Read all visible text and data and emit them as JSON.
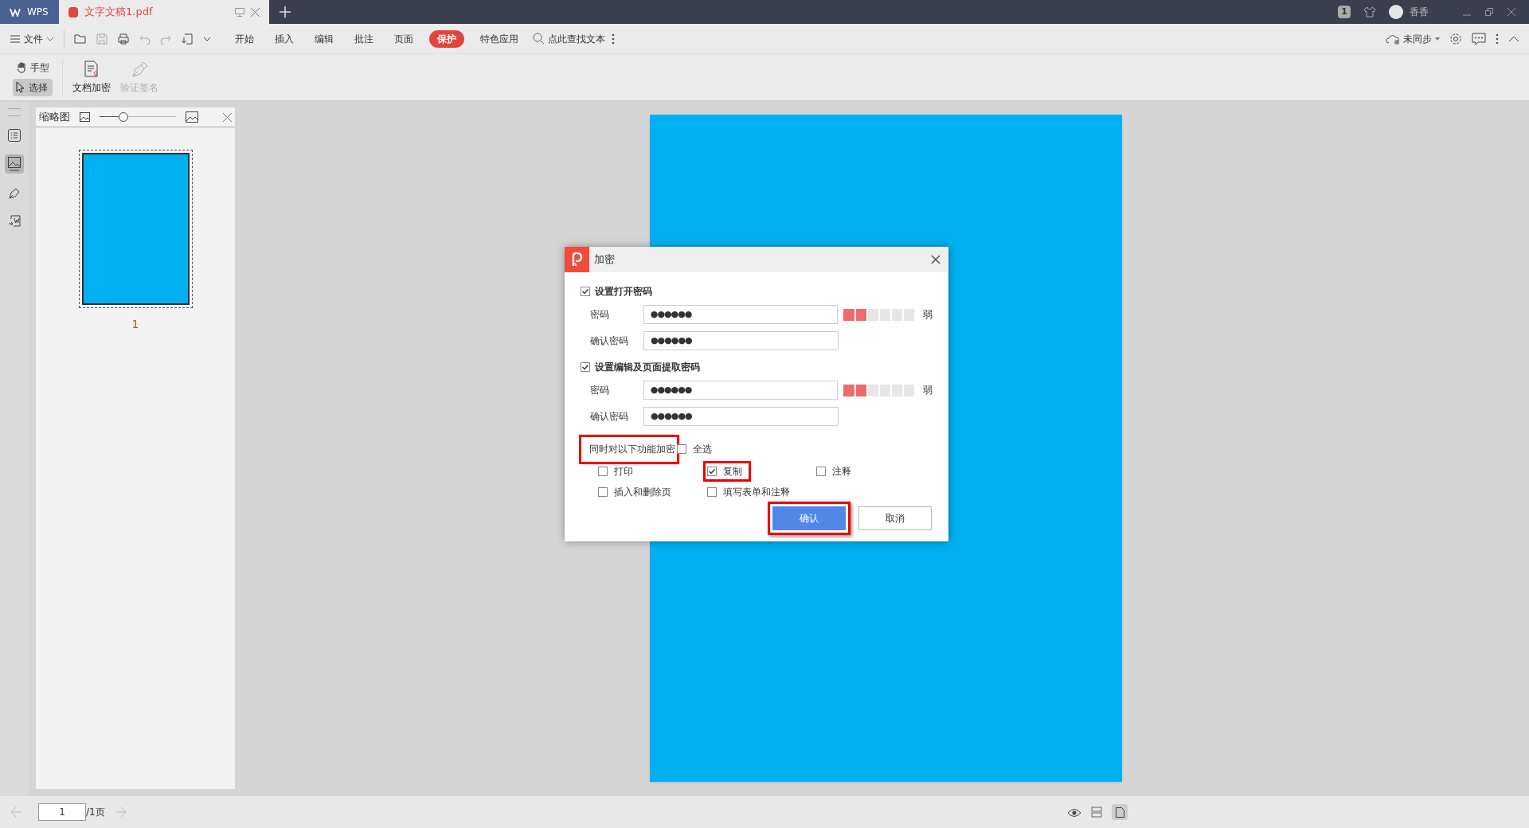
{
  "tabs": [
    {
      "label": "WPS",
      "kind": "home",
      "selected": false
    },
    {
      "label": "文字文稿1.pdf",
      "kind": "doc",
      "selected": true
    }
  ],
  "title_bar": {
    "window_badge": "1",
    "user": "香香"
  },
  "menu": {
    "file": "文件",
    "items": [
      {
        "label": "开始",
        "selected": false
      },
      {
        "label": "插入",
        "selected": false
      },
      {
        "label": "编辑",
        "selected": false
      },
      {
        "label": "批注",
        "selected": false
      },
      {
        "label": "页面",
        "selected": false
      },
      {
        "label": "保护",
        "selected": true
      },
      {
        "label": "特色应用",
        "selected": false
      }
    ],
    "search": {
      "placeholder": "点此查找文本"
    },
    "sync": "未同步"
  },
  "ribbon": {
    "tools": [
      {
        "label": "手型",
        "kind": "hand",
        "selected": false
      },
      {
        "label": "选择",
        "kind": "pointer",
        "selected": true
      }
    ],
    "actions": [
      {
        "label": "文档加密",
        "kind": "encrypt",
        "disabled": false
      },
      {
        "label": "验证签名",
        "kind": "sign",
        "disabled": true
      }
    ]
  },
  "sidebar": {
    "tabs": [
      {
        "kind": "outline",
        "selected": false
      },
      {
        "kind": "thumbnail",
        "selected": true
      },
      {
        "kind": "pen",
        "selected": false
      },
      {
        "kind": "convert",
        "selected": false
      }
    ]
  },
  "thumbnail_panel": {
    "title": "缩略图",
    "zoom": {
      "level": 0.28
    },
    "pages": [
      {
        "label": "1",
        "selected": true
      }
    ]
  },
  "dialog": {
    "title": "加密",
    "sections": [
      {
        "label": "设置打开密码",
        "checked": true,
        "password_label": "密码",
        "password": "●●●●●●",
        "strength": {
          "level": 0.33,
          "label": "弱"
        },
        "confirm_label": "确认密码",
        "confirm": "●●●●●●"
      },
      {
        "label": "设置编辑及页面提取密码",
        "checked": true,
        "password_label": "密码",
        "password": "●●●●●●",
        "strength": {
          "level": 0.33,
          "label": "弱"
        },
        "confirm_label": "确认密码",
        "confirm": "●●●●●●"
      }
    ],
    "permissions": {
      "label": "同时对以下功能加密",
      "highlighted": true,
      "select_all": {
        "label": "全选",
        "checked": false
      },
      "options": [
        {
          "label": "打印",
          "checked": false,
          "highlighted": false
        },
        {
          "label": "复制",
          "checked": true,
          "highlighted": true
        },
        {
          "label": "注释",
          "checked": false,
          "highlighted": false
        },
        {
          "label": "插入和删除页",
          "checked": false,
          "highlighted": false
        },
        {
          "label": "填写表单和注释",
          "checked": false,
          "highlighted": false
        }
      ]
    },
    "buttons": [
      {
        "label": "确认",
        "kind": "primary",
        "highlighted": true
      },
      {
        "label": "取消",
        "kind": "secondary",
        "highlighted": false
      }
    ]
  },
  "status_bar": {
    "page_input": "1",
    "page_total": "/1页"
  }
}
